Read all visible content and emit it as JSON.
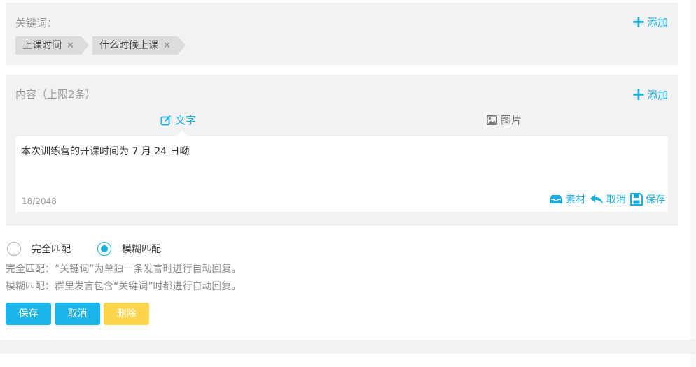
{
  "keywords": {
    "label": "关键词：",
    "add_label": "添加",
    "tags": [
      "上课时间",
      "什么时候上课"
    ],
    "remove_symbol": "✕"
  },
  "content": {
    "label": "内容（上限2条）",
    "add_label": "添加",
    "tabs": {
      "text": "文字",
      "image": "图片"
    },
    "editor_text": "本次训练营的开课时间为 7 月 24 日呦",
    "counter": "18/2048",
    "actions": {
      "material": "素材",
      "cancel": "取消",
      "save": "保存"
    }
  },
  "match": {
    "exact_label": "完全匹配",
    "fuzzy_label": "模糊匹配",
    "selected": "fuzzy",
    "exact_desc": "完全匹配：“关键词”为单独一条发言时进行自动回复。",
    "fuzzy_desc": "模糊匹配：群里发言包含“关键词”时都进行自动回复。"
  },
  "buttons": {
    "save": "保存",
    "cancel": "取消",
    "delete": "删除"
  },
  "colors": {
    "accent": "#1aabdf",
    "primary_button": "#1ab5ea",
    "delete_button": "#fdd54d",
    "panel_bg": "#f2f2f2"
  }
}
